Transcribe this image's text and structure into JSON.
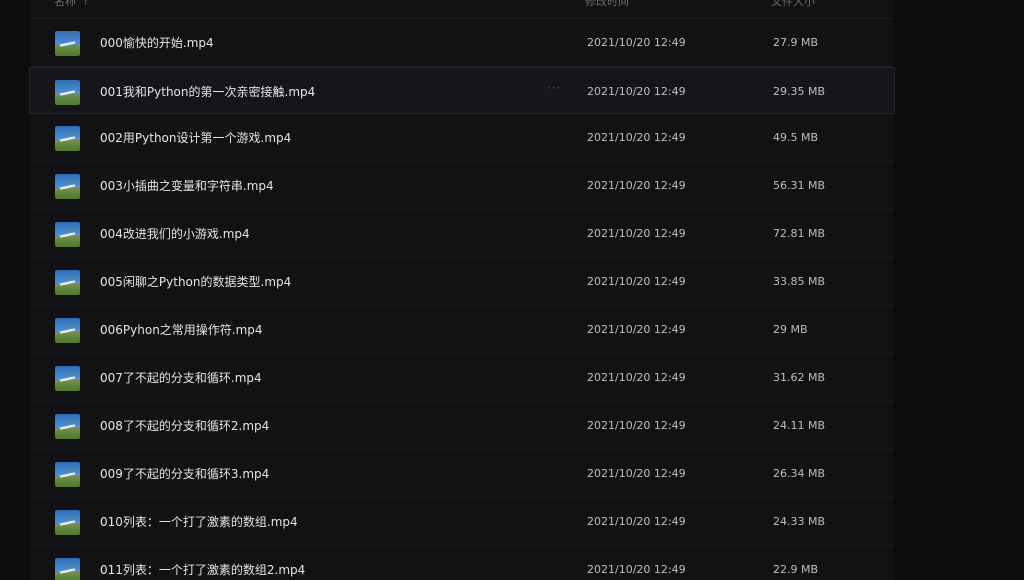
{
  "header": {
    "name_label": "名称",
    "sort_glyph": "↑",
    "time_label": "修改时间",
    "size_label": "文件大小"
  },
  "files": [
    {
      "name": "000愉快的开始.mp4",
      "modified": "2021/10/20 12:49",
      "size": "27.9 MB"
    },
    {
      "name": "001我和Python的第一次亲密接触.mp4",
      "modified": "2021/10/20 12:49",
      "size": "29.35 MB",
      "more": "···"
    },
    {
      "name": "002用Python设计第一个游戏.mp4",
      "modified": "2021/10/20 12:49",
      "size": "49.5 MB"
    },
    {
      "name": "003小插曲之变量和字符串.mp4",
      "modified": "2021/10/20 12:49",
      "size": "56.31 MB"
    },
    {
      "name": "004改进我们的小游戏.mp4",
      "modified": "2021/10/20 12:49",
      "size": "72.81 MB"
    },
    {
      "name": "005闲聊之Python的数据类型.mp4",
      "modified": "2021/10/20 12:49",
      "size": "33.85 MB"
    },
    {
      "name": "006Pyhon之常用操作符.mp4",
      "modified": "2021/10/20 12:49",
      "size": "29 MB"
    },
    {
      "name": "007了不起的分支和循环.mp4",
      "modified": "2021/10/20 12:49",
      "size": "31.62 MB"
    },
    {
      "name": "008了不起的分支和循环2.mp4",
      "modified": "2021/10/20 12:49",
      "size": "24.11 MB"
    },
    {
      "name": "009了不起的分支和循环3.mp4",
      "modified": "2021/10/20 12:49",
      "size": "26.34 MB"
    },
    {
      "name": "010列表：一个打了激素的数组.mp4",
      "modified": "2021/10/20 12:49",
      "size": "24.33 MB"
    },
    {
      "name": "011列表：一个打了激素的数组2.mp4",
      "modified": "2021/10/20 12:49",
      "size": "22.9 MB"
    }
  ],
  "colors": {
    "background": "#0d0d0f",
    "panel": "#121215",
    "text": "#e4e4e4"
  }
}
